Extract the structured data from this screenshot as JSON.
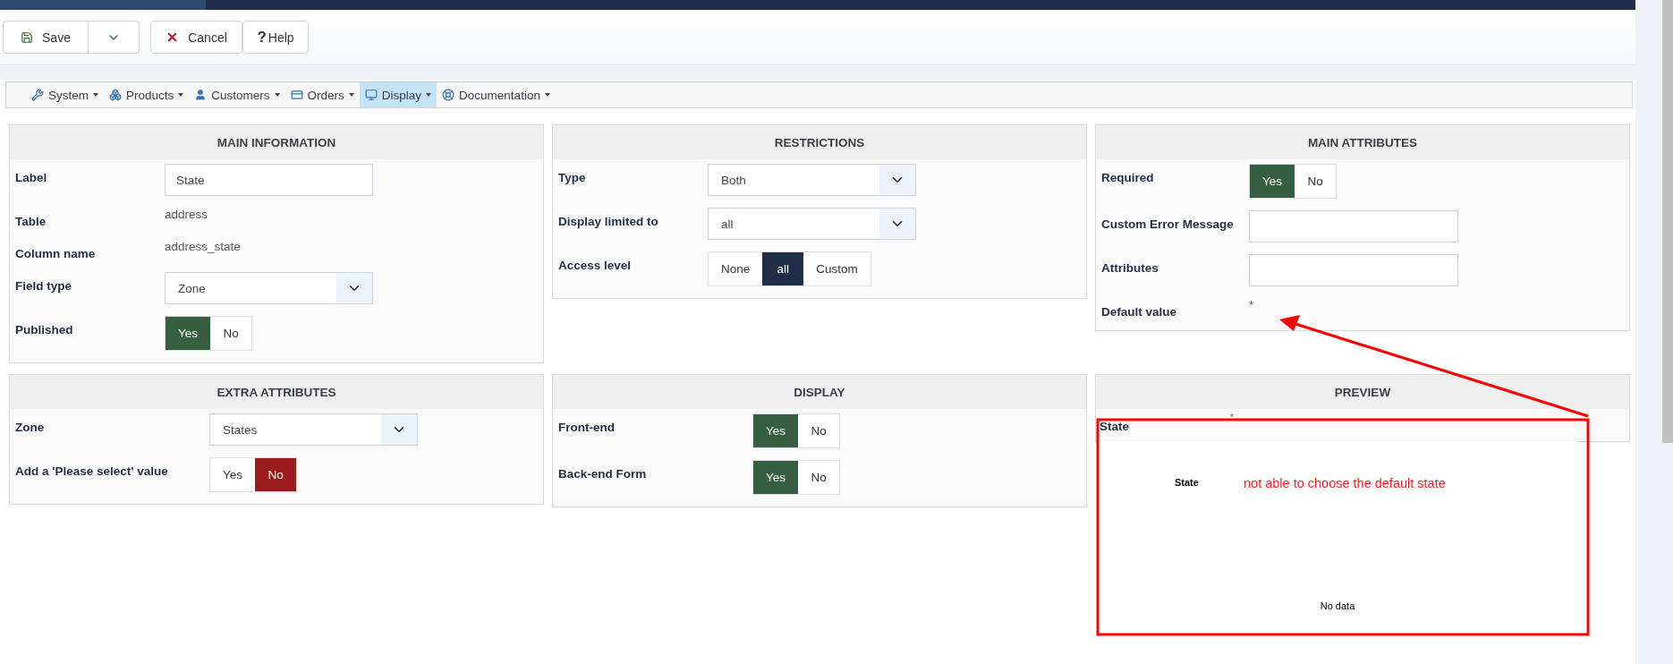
{
  "toolbar": {
    "buttons": [
      {
        "kind": "save",
        "label": "Save"
      },
      {
        "kind": "dropdown"
      },
      {
        "kind": "cancel",
        "label": "Cancel"
      },
      {
        "kind": "help",
        "label": "Help",
        "glyph": "?"
      }
    ]
  },
  "menu": [
    {
      "kind": "wrench",
      "label": "System",
      "selected": false
    },
    {
      "kind": "boxes",
      "label": "Products",
      "selected": false
    },
    {
      "kind": "user",
      "label": "Customers",
      "selected": false
    },
    {
      "kind": "card",
      "label": "Orders",
      "selected": false
    },
    {
      "kind": "monitor",
      "label": "Display",
      "selected": true
    },
    {
      "kind": "lifebuoy",
      "label": "Documentation",
      "selected": false
    }
  ],
  "panels": [
    {
      "title": "MAIN INFORMATION",
      "rows": [
        {
          "kind": "input",
          "label": "Label",
          "value": "State"
        },
        {
          "kind": "static",
          "label": "Table",
          "value": "address"
        },
        {
          "kind": "static",
          "label": "Column name",
          "value": "address_state"
        },
        {
          "kind": "select",
          "label": "Field type",
          "value": "Zone"
        },
        {
          "kind": "toggle",
          "label": "Published",
          "options": [
            {
              "label": "Yes",
              "kind": "positive",
              "selected": true
            },
            {
              "label": "No",
              "kind": "negative",
              "selected": false
            }
          ]
        }
      ]
    },
    {
      "title": "RESTRICTIONS",
      "rows": [
        {
          "kind": "select",
          "label": "Type",
          "value": "Both"
        },
        {
          "kind": "select",
          "label": "Display limited to",
          "value": "all"
        },
        {
          "kind": "toggle",
          "label": "Access level",
          "options": [
            {
              "label": "None",
              "kind": "dark",
              "selected": false
            },
            {
              "label": "all",
              "kind": "dark",
              "selected": true
            },
            {
              "label": "Custom",
              "kind": "dark",
              "selected": false
            }
          ]
        }
      ]
    },
    {
      "title": "MAIN ATTRIBUTES",
      "rows": [
        {
          "kind": "toggle",
          "label": "Required",
          "options": [
            {
              "label": "Yes",
              "kind": "positive",
              "selected": true
            },
            {
              "label": "No",
              "kind": "negative",
              "selected": false
            }
          ]
        },
        {
          "kind": "input",
          "label": "Custom Error Message"
        },
        {
          "kind": "input",
          "label": "Attributes"
        },
        {
          "kind": "static",
          "label": "Default value",
          "value": "*"
        }
      ]
    },
    {
      "title": "EXTRA ATTRIBUTES",
      "rows": [
        {
          "kind": "select",
          "label": "Zone",
          "value": "States"
        },
        {
          "kind": "toggle",
          "label": "Add a 'Please select' value",
          "options": [
            {
              "label": "Yes",
              "kind": "positive",
              "selected": false
            },
            {
              "label": "No",
              "kind": "negative",
              "selected": true
            }
          ]
        }
      ]
    },
    {
      "title": "DISPLAY",
      "rows": [
        {
          "kind": "toggle",
          "label": "Front-end",
          "options": [
            {
              "label": "Yes",
              "kind": "positive",
              "selected": true
            },
            {
              "label": "No",
              "kind": "negative",
              "selected": false
            }
          ]
        },
        {
          "kind": "toggle",
          "label": "Back-end Form",
          "options": [
            {
              "label": "Yes",
              "kind": "positive",
              "selected": true
            },
            {
              "label": "No",
              "kind": "negative",
              "selected": false
            }
          ]
        }
      ]
    },
    {
      "title": "PREVIEW",
      "kind": "preview",
      "label": "State",
      "marker": "*",
      "popup": {
        "title": "State",
        "empty": "No data"
      }
    }
  ],
  "annotation": {
    "text": "not able to choose the default state"
  }
}
